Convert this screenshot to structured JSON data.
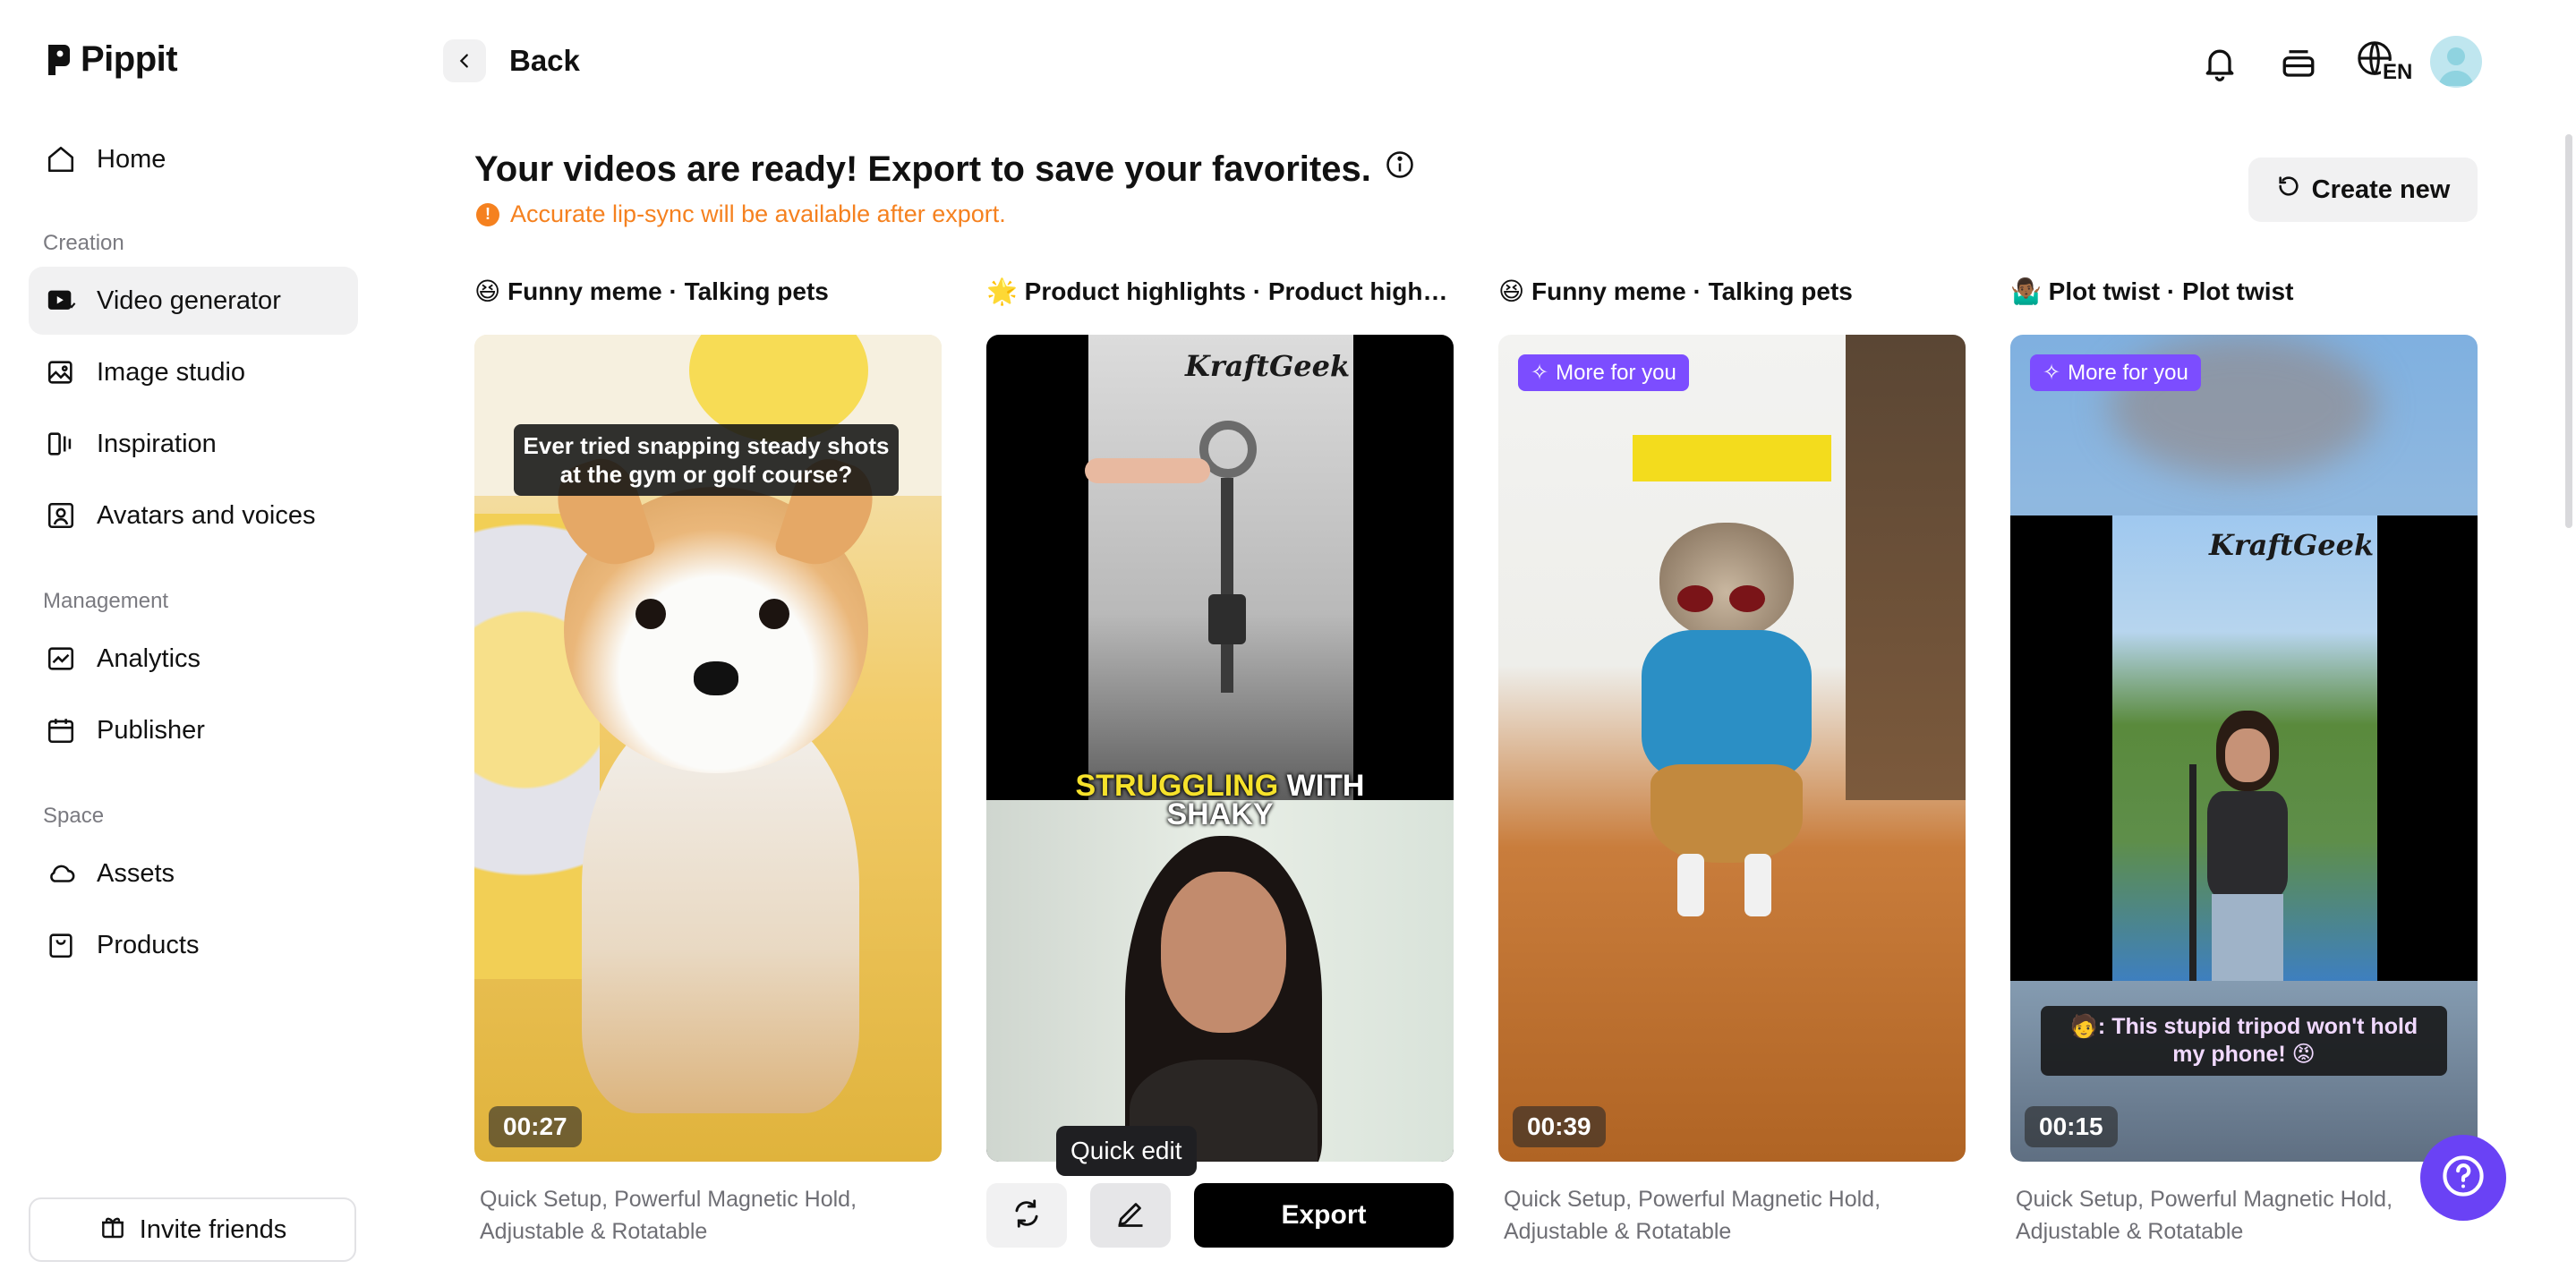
{
  "app": {
    "name": "Pippit"
  },
  "sidebar": {
    "home": "Home",
    "sections": {
      "creation": "Creation",
      "management": "Management",
      "space": "Space"
    },
    "items": {
      "video_generator": "Video generator",
      "image_studio": "Image studio",
      "inspiration": "Inspiration",
      "avatars_voices": "Avatars and voices",
      "analytics": "Analytics",
      "publisher": "Publisher",
      "assets": "Assets",
      "products": "Products"
    },
    "active_item": "Video generator",
    "invite": "Invite friends"
  },
  "topbar": {
    "back": "Back",
    "language": "EN"
  },
  "header": {
    "title": "Your videos are ready! Export to save your favorites.",
    "notice": "Accurate lip-sync will be available after export.",
    "create_new": "Create new"
  },
  "cards": [
    {
      "emoji": "😆",
      "title": "Funny meme · Talking pets",
      "caption": "Ever tried snapping steady shots at the gym or golf course?",
      "duration": "00:27",
      "description": "Quick Setup, Powerful Magnetic Hold, Adjustable & Rotatable"
    },
    {
      "emoji": "🌟",
      "title": "Product highlights · Product highlig...",
      "brand": "KraftGeek",
      "overlay_highlight": "STRUGGLING",
      "overlay_rest": "WITH",
      "overlay_line2": "SHAKY",
      "tooltip": "Quick edit",
      "export": "Export"
    },
    {
      "emoji": "😆",
      "title": "Funny meme · Talking pets",
      "badge": "More for you",
      "duration": "00:39",
      "description": "Quick Setup, Powerful Magnetic Hold, Adjustable & Rotatable"
    },
    {
      "emoji": "🤷🏾‍♂️",
      "title": "Plot twist · Plot twist",
      "badge": "More for you",
      "brand": "KraftGeek",
      "caption": "🧑: This stupid tripod won't hold my phone! 😡",
      "duration": "00:15",
      "description": "Quick Setup, Powerful Magnetic Hold, Adjustable & Rotatable"
    }
  ],
  "colors": {
    "accent": "#7c4dff",
    "warning": "#f5811f",
    "help_fab": "#6a42f5"
  },
  "icons": [
    "home-icon",
    "video-icon",
    "image-icon",
    "inspiration-icon",
    "avatar-icon",
    "analytics-icon",
    "calendar-icon",
    "cloud-icon",
    "bag-icon",
    "gift-icon",
    "bell-icon",
    "layers-icon",
    "globe-icon",
    "info-icon",
    "refresh-icon",
    "pencil-icon",
    "help-icon"
  ]
}
